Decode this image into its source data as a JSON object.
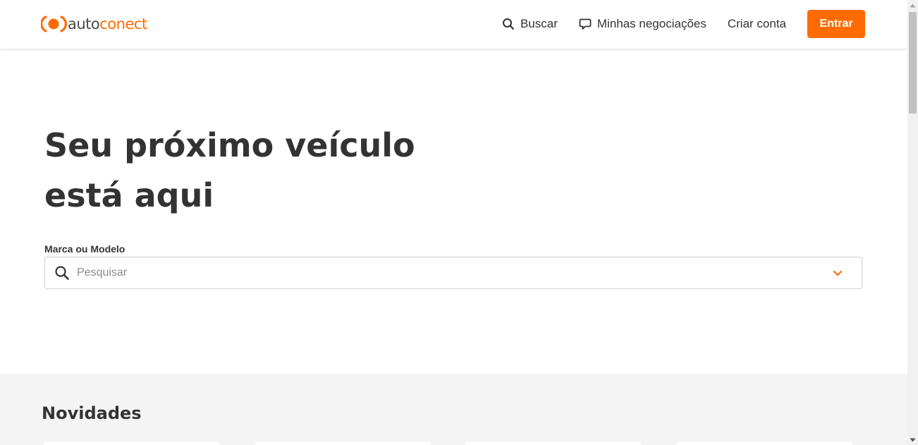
{
  "brand": {
    "name_part1": "auto",
    "name_part2": "conect",
    "accent_color": "#ff6b00",
    "logo_icon": "broadcast-dot-icon"
  },
  "nav": {
    "search": {
      "label": "Buscar",
      "icon": "search-icon"
    },
    "negotiations": {
      "label": "Minhas negociações",
      "icon": "chat-bubble-icon"
    },
    "create_account": {
      "label": "Criar conta"
    },
    "login": {
      "label": "Entrar"
    }
  },
  "hero": {
    "title_line1": "Seu próximo veículo",
    "title_line2": "está aqui",
    "field_label": "Marca ou Modelo",
    "search_placeholder": "Pesquisar",
    "search_value": "",
    "dropdown_icon": "chevron-down-icon"
  },
  "news": {
    "title": "Novidades"
  }
}
